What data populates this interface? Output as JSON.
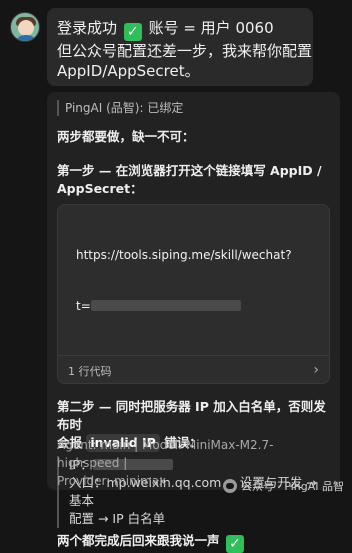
{
  "user_message": {
    "line1_prefix": "登录成功",
    "line1_suffix": "账号 = 用户 0060",
    "line2": "但公众号配置还差一步，我来帮你配置",
    "line3": "AppID/AppSecret。"
  },
  "bot": {
    "header": "PingAI (品智): 已绑定",
    "intro": "两步都要做，缺一不可：",
    "step1": {
      "title_line1": "第一步 — 在浏览器打开这个链接填写 AppID /",
      "title_line2": "AppSecret：",
      "url_line1": "https://tools.siping.me/skill/wechat?",
      "url_line2_prefix": "t=",
      "code_footer": "1 行代码",
      "chevron": "›"
    },
    "step2": {
      "line1": "第二步 — 同时把服务器 IP 加入白名单，否则发布时",
      "line2_prefix": "会报",
      "line2_pill": "invalid IP",
      "line2_suffix": "错误：",
      "ip_label": "IP：",
      "entry_line1": "入口：mp.weixin.qq.com → 设置与开发 → 基本",
      "entry_line2": "配置 → IP 白名单"
    },
    "closing": "两个都完成后回来跟我说一声",
    "meta_line1": "Agent: main | Model: MiniMax-M2.7-highspeed |",
    "meta_line2": "Provider: minimax"
  },
  "watermark": "公众号 · PingAI 品智",
  "icons": {
    "check": "check-mark-emoji",
    "chevron": "chevron-right-icon"
  },
  "colors": {
    "background": "#151515",
    "bubble": "#2a2a2a",
    "card": "#222222",
    "check_green": "#2fbe5a"
  }
}
